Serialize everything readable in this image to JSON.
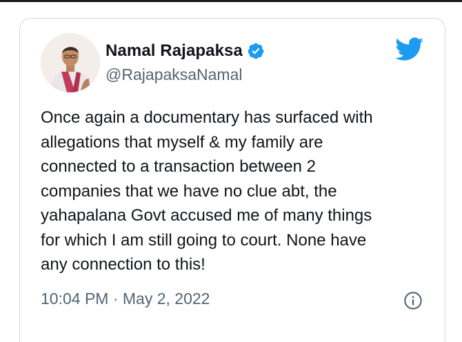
{
  "tweet": {
    "author": {
      "display_name": "Namal Rajapaksa",
      "handle": "@RajapaksaNamal",
      "verified": true,
      "avatar_icon": "profile-photo"
    },
    "text": "Once again a documentary has surfaced with\nallegations that myself & my family are\nconnected to a transaction between 2\ncompanies that we have no clue abt, the\nyahapalana Govt accused me of many things\nfor which I am still going to court. None have\nany connection to this!",
    "timestamp": "10:04 PM · May 2, 2022",
    "brand_icon": "twitter-bird-icon",
    "info_icon": "info-circle-icon"
  },
  "colors": {
    "brand_blue": "#1d9bf0",
    "text_primary": "#0f1419",
    "text_secondary": "#536471",
    "border": "#cfd9de"
  }
}
